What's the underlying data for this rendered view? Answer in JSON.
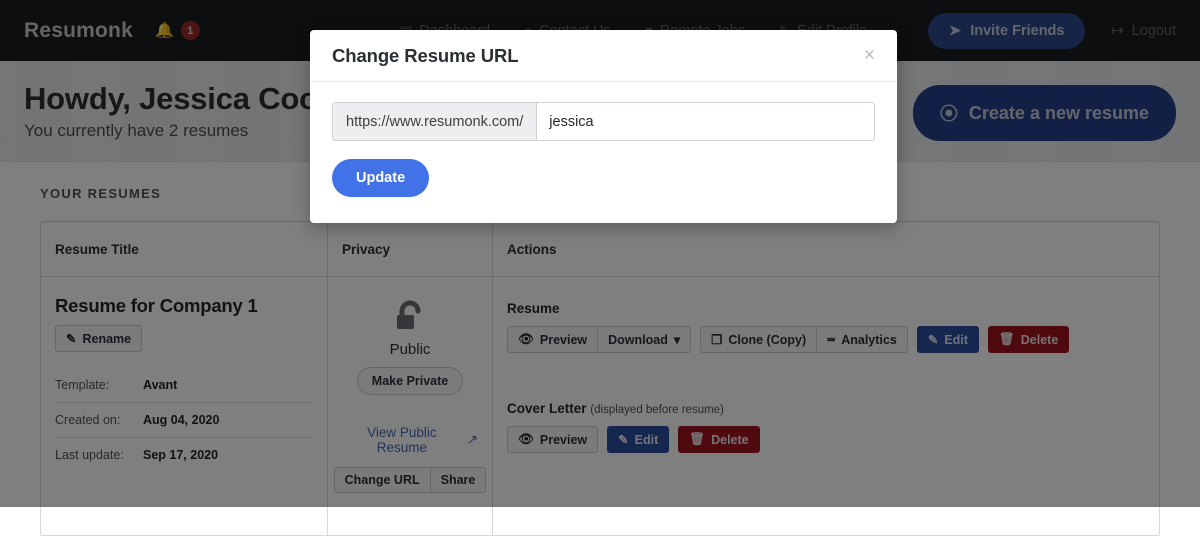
{
  "navbar": {
    "brand": "Resumonk",
    "notification_count": "1",
    "links": [
      {
        "label": "Dashboard",
        "icon": "dashboard-icon",
        "glyph": "▤"
      },
      {
        "label": "Contact Us",
        "icon": "chat-icon",
        "glyph": "●"
      },
      {
        "label": "Remote Jobs",
        "icon": "briefcase-icon",
        "glyph": "▬"
      },
      {
        "label": "Edit Profile",
        "icon": "pencil-icon",
        "glyph": "✎"
      }
    ],
    "invite_label": "Invite Friends",
    "invite_icon": "paper-plane-icon",
    "logout_label": "Logout",
    "logout_icon": "sign-out-icon"
  },
  "hero": {
    "greeting": "Howdy, Jessica Coo",
    "subtitle": "You currently have 2 resumes",
    "create_label": "Create a new resume",
    "create_icon": "plus-circle-icon"
  },
  "resumes_section": {
    "title": "YOUR RESUMES",
    "columns": [
      "Resume Title",
      "Privacy",
      "Actions"
    ],
    "row": {
      "title": "Resume for Company 1",
      "rename_label": "Rename",
      "rename_icon": "pencil-icon",
      "meta": [
        {
          "key": "Template:",
          "value": "Avant"
        },
        {
          "key": "Created on:",
          "value": "Aug 04, 2020"
        },
        {
          "key": "Last update:",
          "value": "Sep 17, 2020"
        }
      ],
      "privacy": {
        "icon": "unlock-icon",
        "status": "Public",
        "toggle_label": "Make Private",
        "view_label": "View Public Resume",
        "view_icon": "external-link-icon",
        "change_url_label": "Change URL",
        "share_label": "Share"
      },
      "actions": {
        "resume_heading": "Resume",
        "resume_buttons": [
          {
            "label": "Preview",
            "icon": "eye-icon",
            "style": "light"
          },
          {
            "label": "Download",
            "icon": "chevron-down-icon",
            "style": "light"
          },
          {
            "label": "Clone (Copy)",
            "icon": "copy-icon",
            "style": "light"
          },
          {
            "label": "Analytics",
            "icon": "bar-chart-icon",
            "style": "light"
          },
          {
            "label": "Edit",
            "icon": "pencil-icon",
            "style": "primary"
          },
          {
            "label": "Delete",
            "icon": "trash-icon",
            "style": "danger"
          }
        ],
        "cover_heading": "Cover Letter",
        "cover_note": "(displayed before resume)",
        "cover_buttons": [
          {
            "label": "Preview",
            "icon": "eye-icon",
            "style": "light"
          },
          {
            "label": "Edit",
            "icon": "pencil-icon",
            "style": "primary"
          },
          {
            "label": "Delete",
            "icon": "trash-icon",
            "style": "danger"
          }
        ]
      }
    }
  },
  "modal": {
    "title": "Change Resume URL",
    "close_icon": "close-icon",
    "url_prefix": "https://www.resumonk.com/",
    "slug_value": "jessica",
    "slug_placeholder": "",
    "update_label": "Update"
  },
  "colors": {
    "navbar_bg": "#181c1e",
    "hero_bg": "#e9ecef",
    "primary_blue": "#4272e8",
    "invite_blue": "#2d4a8a",
    "create_blue": "#27418b",
    "edit_blue": "#2a4f9e",
    "danger_red": "#9e1520",
    "badge_red": "#9c2a2a",
    "link_blue": "#4a68b5",
    "overlay": "#000000"
  }
}
